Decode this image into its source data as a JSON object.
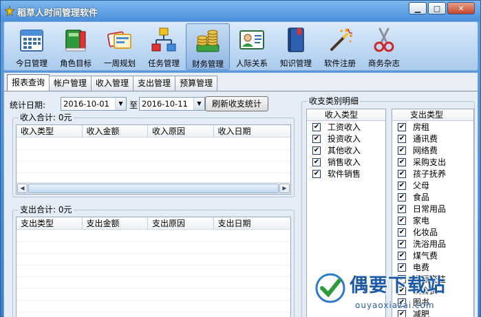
{
  "window": {
    "title": "稻草人时间管理软件",
    "min_glyph": "▁",
    "max_glyph": "□",
    "close_glyph": "✕"
  },
  "toolbar": [
    {
      "key": "today",
      "label": "今日管理",
      "icon": "calendar-icon"
    },
    {
      "key": "role",
      "label": "角色目标",
      "icon": "books-icon"
    },
    {
      "key": "week",
      "label": "一周规划",
      "icon": "cards-icon"
    },
    {
      "key": "task",
      "label": "任务管理",
      "icon": "flowchart-icon"
    },
    {
      "key": "finance",
      "label": "财务管理",
      "icon": "coins-icon",
      "active": true
    },
    {
      "key": "people",
      "label": "人际关系",
      "icon": "contact-card-icon"
    },
    {
      "key": "knowledge",
      "label": "知识管理",
      "icon": "book-icon"
    },
    {
      "key": "register",
      "label": "软件注册",
      "icon": "magic-wand-icon"
    },
    {
      "key": "misc",
      "label": "商务杂志",
      "icon": "scissors-icon"
    }
  ],
  "tabs": [
    {
      "label": "报表查询",
      "active": true
    },
    {
      "label": "帐户管理"
    },
    {
      "label": "收入管理"
    },
    {
      "label": "支出管理"
    },
    {
      "label": "预算管理"
    }
  ],
  "filter": {
    "label": "统计日期:",
    "from": "2016-10-01",
    "to_label": "至",
    "to": "2016-10-11",
    "refresh_button": "刷新收支统计"
  },
  "income": {
    "title": "收入合计: 0元",
    "columns": [
      "收入类型",
      "收入金额",
      "收入原因",
      "收入日期"
    ]
  },
  "expense": {
    "title": "支出合计: 0元",
    "columns": [
      "支出类型",
      "支出金额",
      "支出原因",
      "支出日期"
    ]
  },
  "categories": {
    "title": "收支类别明细",
    "income_header": "收入类型",
    "income_items": [
      "工资收入",
      "投资收入",
      "其他收入",
      "销售收入",
      "软件销售"
    ],
    "expense_header": "支出类型",
    "expense_items": [
      "房租",
      "通讯费",
      "网络费",
      "采购支出",
      "孩子抚养",
      "父母",
      "食品",
      "日常用品",
      "家电",
      "化妆品",
      "洗浴用品",
      "煤气费",
      "电费",
      "人际交往",
      "饮食费",
      "图书",
      "减肥"
    ]
  },
  "watermark": {
    "text": "偶要下载站",
    "sub": "ouyaoxiazai.com"
  },
  "check_glyph": "✔",
  "scroll": {
    "left": "◀",
    "right": "▶"
  }
}
